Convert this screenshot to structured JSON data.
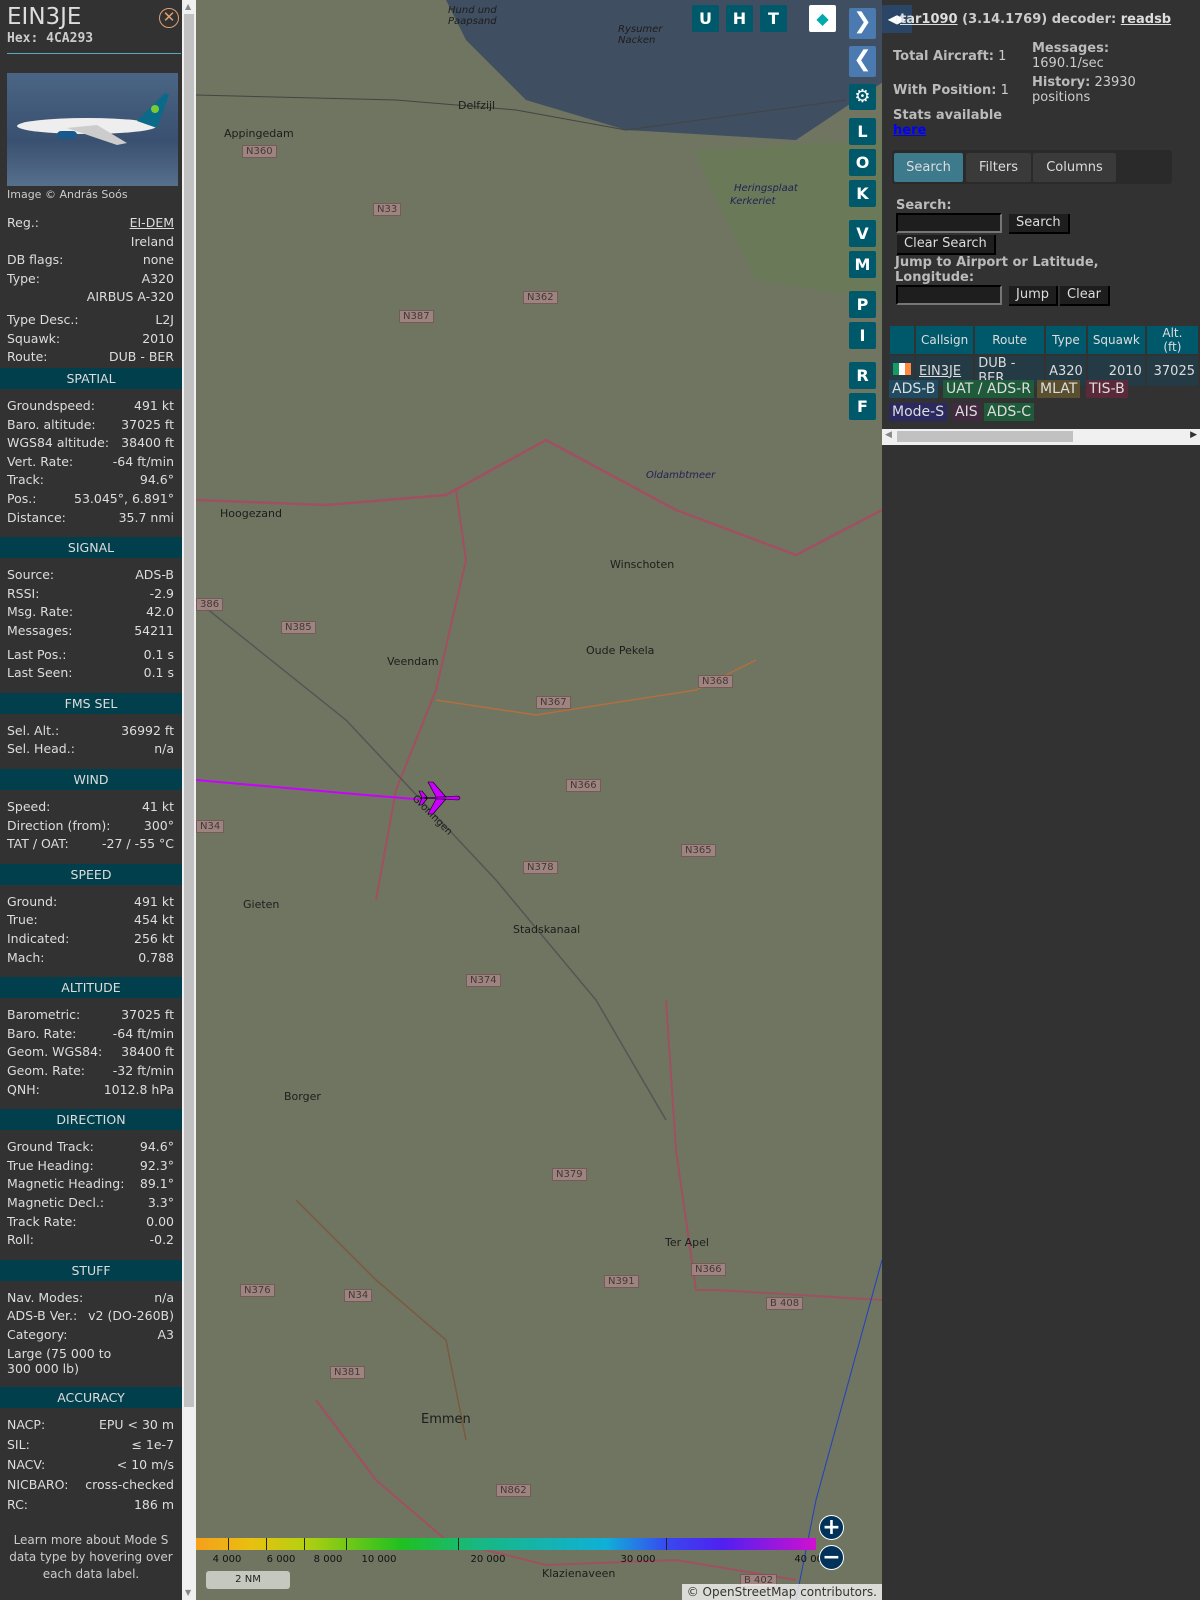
{
  "aircraft": {
    "callsign": "EIN3JE",
    "hex_label": "Hex:",
    "hex": "4CA293",
    "image_credit": "Image © András Soós",
    "info": [
      [
        "Reg.:",
        "EI-DEM"
      ],
      [
        "",
        "Ireland"
      ],
      [
        "DB flags:",
        "none"
      ],
      [
        "Type:",
        "A320"
      ],
      [
        "",
        "AIRBUS A-320"
      ],
      [
        "Type Desc.:",
        "L2J"
      ],
      [
        "Squawk:",
        "2010"
      ],
      [
        "Route:",
        "DUB - BER"
      ]
    ],
    "sections": [
      {
        "title": "SPATIAL",
        "rows": [
          [
            "Groundspeed:",
            "491 kt"
          ],
          [
            "Baro. altitude:",
            "37025 ft"
          ],
          [
            "WGS84 altitude:",
            "38400 ft"
          ],
          [
            "Vert. Rate:",
            "-64 ft/min"
          ],
          [
            "Track:",
            "94.6°"
          ],
          [
            "Pos.:",
            "53.045°, 6.891°"
          ],
          [
            "Distance:",
            "35.7 nmi"
          ]
        ]
      },
      {
        "title": "SIGNAL",
        "rows": [
          [
            "Source:",
            "ADS-B"
          ],
          [
            "RSSI:",
            "-2.9"
          ],
          [
            "Msg. Rate:",
            "42.0"
          ],
          [
            "Messages:",
            "54211"
          ],
          [
            "Last Pos.:",
            "0.1 s"
          ],
          [
            "Last Seen:",
            "0.1 s"
          ]
        ]
      },
      {
        "title": "FMS SEL",
        "rows": [
          [
            "Sel. Alt.:",
            "36992 ft"
          ],
          [
            "Sel. Head.:",
            "n/a"
          ]
        ]
      },
      {
        "title": "WIND",
        "rows": [
          [
            "Speed:",
            "41 kt"
          ],
          [
            "Direction (from):",
            "300°"
          ],
          [
            "TAT / OAT:",
            "-27 / -55 °C"
          ]
        ]
      },
      {
        "title": "SPEED",
        "rows": [
          [
            "Ground:",
            "491 kt"
          ],
          [
            "True:",
            "454 kt"
          ],
          [
            "Indicated:",
            "256 kt"
          ],
          [
            "Mach:",
            "0.788"
          ]
        ]
      },
      {
        "title": "ALTITUDE",
        "rows": [
          [
            "Barometric:",
            "37025 ft"
          ],
          [
            "Baro. Rate:",
            "-64 ft/min"
          ],
          [
            "Geom. WGS84:",
            "38400 ft"
          ],
          [
            "Geom. Rate:",
            "-32 ft/min"
          ],
          [
            "QNH:",
            "1012.8 hPa"
          ]
        ]
      },
      {
        "title": "DIRECTION",
        "rows": [
          [
            "Ground Track:",
            "94.6°"
          ],
          [
            "True Heading:",
            "92.3°"
          ],
          [
            "Magnetic Heading:",
            "89.1°"
          ],
          [
            "Magnetic Decl.:",
            "3.3°"
          ],
          [
            "Track Rate:",
            "0.00"
          ],
          [
            "Roll:",
            "-0.2"
          ]
        ]
      },
      {
        "title": "STUFF",
        "rows": [
          [
            "Nav. Modes:",
            "n/a"
          ],
          [
            "ADS-B Ver.:",
            "v2 (DO-260B)"
          ],
          [
            "Category:",
            "A3"
          ]
        ],
        "note": "Large (75 000 to 300 000 lb)"
      },
      {
        "title": "ACCURACY",
        "rows": [
          [
            "NACP:",
            "EPU < 30 m"
          ],
          [
            "SIL:",
            "≤ 1e-7"
          ],
          [
            "NACV:",
            "< 10 m/s"
          ],
          [
            "NICBARO:",
            "cross-checked"
          ],
          [
            "RC:",
            "186 m"
          ]
        ]
      }
    ],
    "footer": "Learn more about Mode S data type by hovering over each data label."
  },
  "map": {
    "buttons_top": [
      "U",
      "H",
      "T"
    ],
    "side_buttons": [
      "L",
      "O",
      "K",
      "V",
      "M",
      "P",
      "I",
      "R",
      "F"
    ],
    "places": [
      "Delfzijl",
      "Appingedam",
      "Hoogezand",
      "Winschoten",
      "Veendam",
      "Oude Pekela",
      "Gieten",
      "Stadskanaal",
      "Borger",
      "Ter Apel",
      "Emmen",
      "Klazienaveen",
      "Hund und Paapsand",
      "Rysumer Nacken",
      "Heringsplaat",
      "Kerkeriet",
      "Oldambtmeer",
      "Groningen"
    ],
    "roads": [
      "N360",
      "N33",
      "N362",
      "N387",
      "N385",
      "N367",
      "N368",
      "N366",
      "N365",
      "N378",
      "N374",
      "N379",
      "N391",
      "N366",
      "B 408",
      "N376",
      "N34",
      "N381",
      "N862",
      "B 402",
      "N34",
      "386"
    ],
    "colorbar": [
      "4 000",
      "6 000",
      "8 000",
      "10 000",
      "20 000",
      "30 000",
      "40 000+"
    ],
    "scale": "2 NM",
    "attribution": "© OpenStreetMap contributors.",
    "track_color": "#cc00ff"
  },
  "right": {
    "title_prefix": "tar1090",
    "version": "(3.14.1769) decoder:",
    "decoder": "readsb",
    "total_label": "Total Aircraft:",
    "total": "1",
    "pos_label": "With Position:",
    "pos": "1",
    "msg_label": "Messages:",
    "msg": "1690.1/sec",
    "hist_label": "History:",
    "hist": "23930 positions",
    "stats_label": "Stats available",
    "stats_link": "here",
    "tabs": [
      "Search",
      "Filters",
      "Columns"
    ],
    "search_label": "Search:",
    "search_btn": "Search",
    "clear_search": "Clear Search",
    "jump_label": "Jump to Airport or Latitude, Longitude:",
    "jump_btn": "Jump",
    "clear_btn": "Clear",
    "table": {
      "headers": [
        "",
        "Callsign",
        "Route",
        "Type",
        "Squawk",
        "Alt. (ft)"
      ],
      "rows": [
        [
          "",
          "EIN3JE",
          "DUB - BER",
          "A320",
          "2010",
          "37025"
        ]
      ]
    },
    "legend": [
      {
        "label": "ADS-B",
        "color": "#1f4a60"
      },
      {
        "label": "UAT / ADS-R",
        "color": "#1f5a3a"
      },
      {
        "label": "MLAT",
        "color": "#5a5030"
      },
      {
        "label": "TIS-B",
        "color": "#5a2a3a"
      },
      {
        "label": "Mode-S",
        "color": "#2a2a60"
      },
      {
        "label": "AIS",
        "color": "#402a40"
      },
      {
        "label": "ADS-C",
        "color": "#1f5a3a"
      }
    ]
  }
}
